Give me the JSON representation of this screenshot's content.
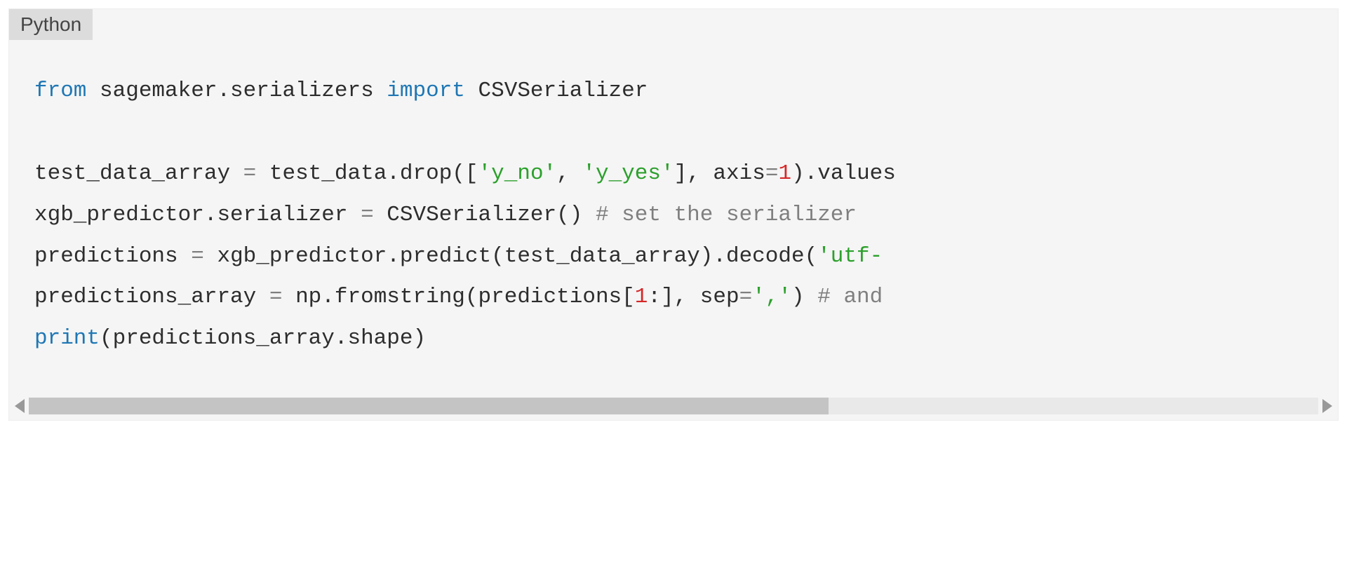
{
  "code_block": {
    "language_label": "Python",
    "scroll_thumb_percent": 62,
    "lines": {
      "l1_from": "from",
      "l1_mid": " sagemaker.serializers ",
      "l1_import": "import",
      "l1_end": " CSVSerializer",
      "l3_a": "test_data_array ",
      "l3_eq": "=",
      "l3_b": " test_data.drop([",
      "l3_s1": "'y_no'",
      "l3_c": ", ",
      "l3_s2": "'y_yes'",
      "l3_d": "], axis",
      "l3_eq2": "=",
      "l3_n1": "1",
      "l3_e": ").values",
      "l4_a": "xgb_predictor.serializer ",
      "l4_eq": "=",
      "l4_b": " CSVSerializer() ",
      "l4_cmt": "# set the serializer ",
      "l5_a": "predictions ",
      "l5_eq": "=",
      "l5_b": " xgb_predictor.predict(test_data_array).decode(",
      "l5_s1": "'utf-",
      "l6_a": "predictions_array ",
      "l6_eq": "=",
      "l6_b": " np.fromstring(predictions[",
      "l6_n1": "1",
      "l6_c": ":], sep",
      "l6_eq2": "=",
      "l6_s1": "','",
      "l6_d": ") ",
      "l6_cmt": "# and",
      "l7_print": "print",
      "l7_body": "(predictions_array.shape)"
    }
  }
}
